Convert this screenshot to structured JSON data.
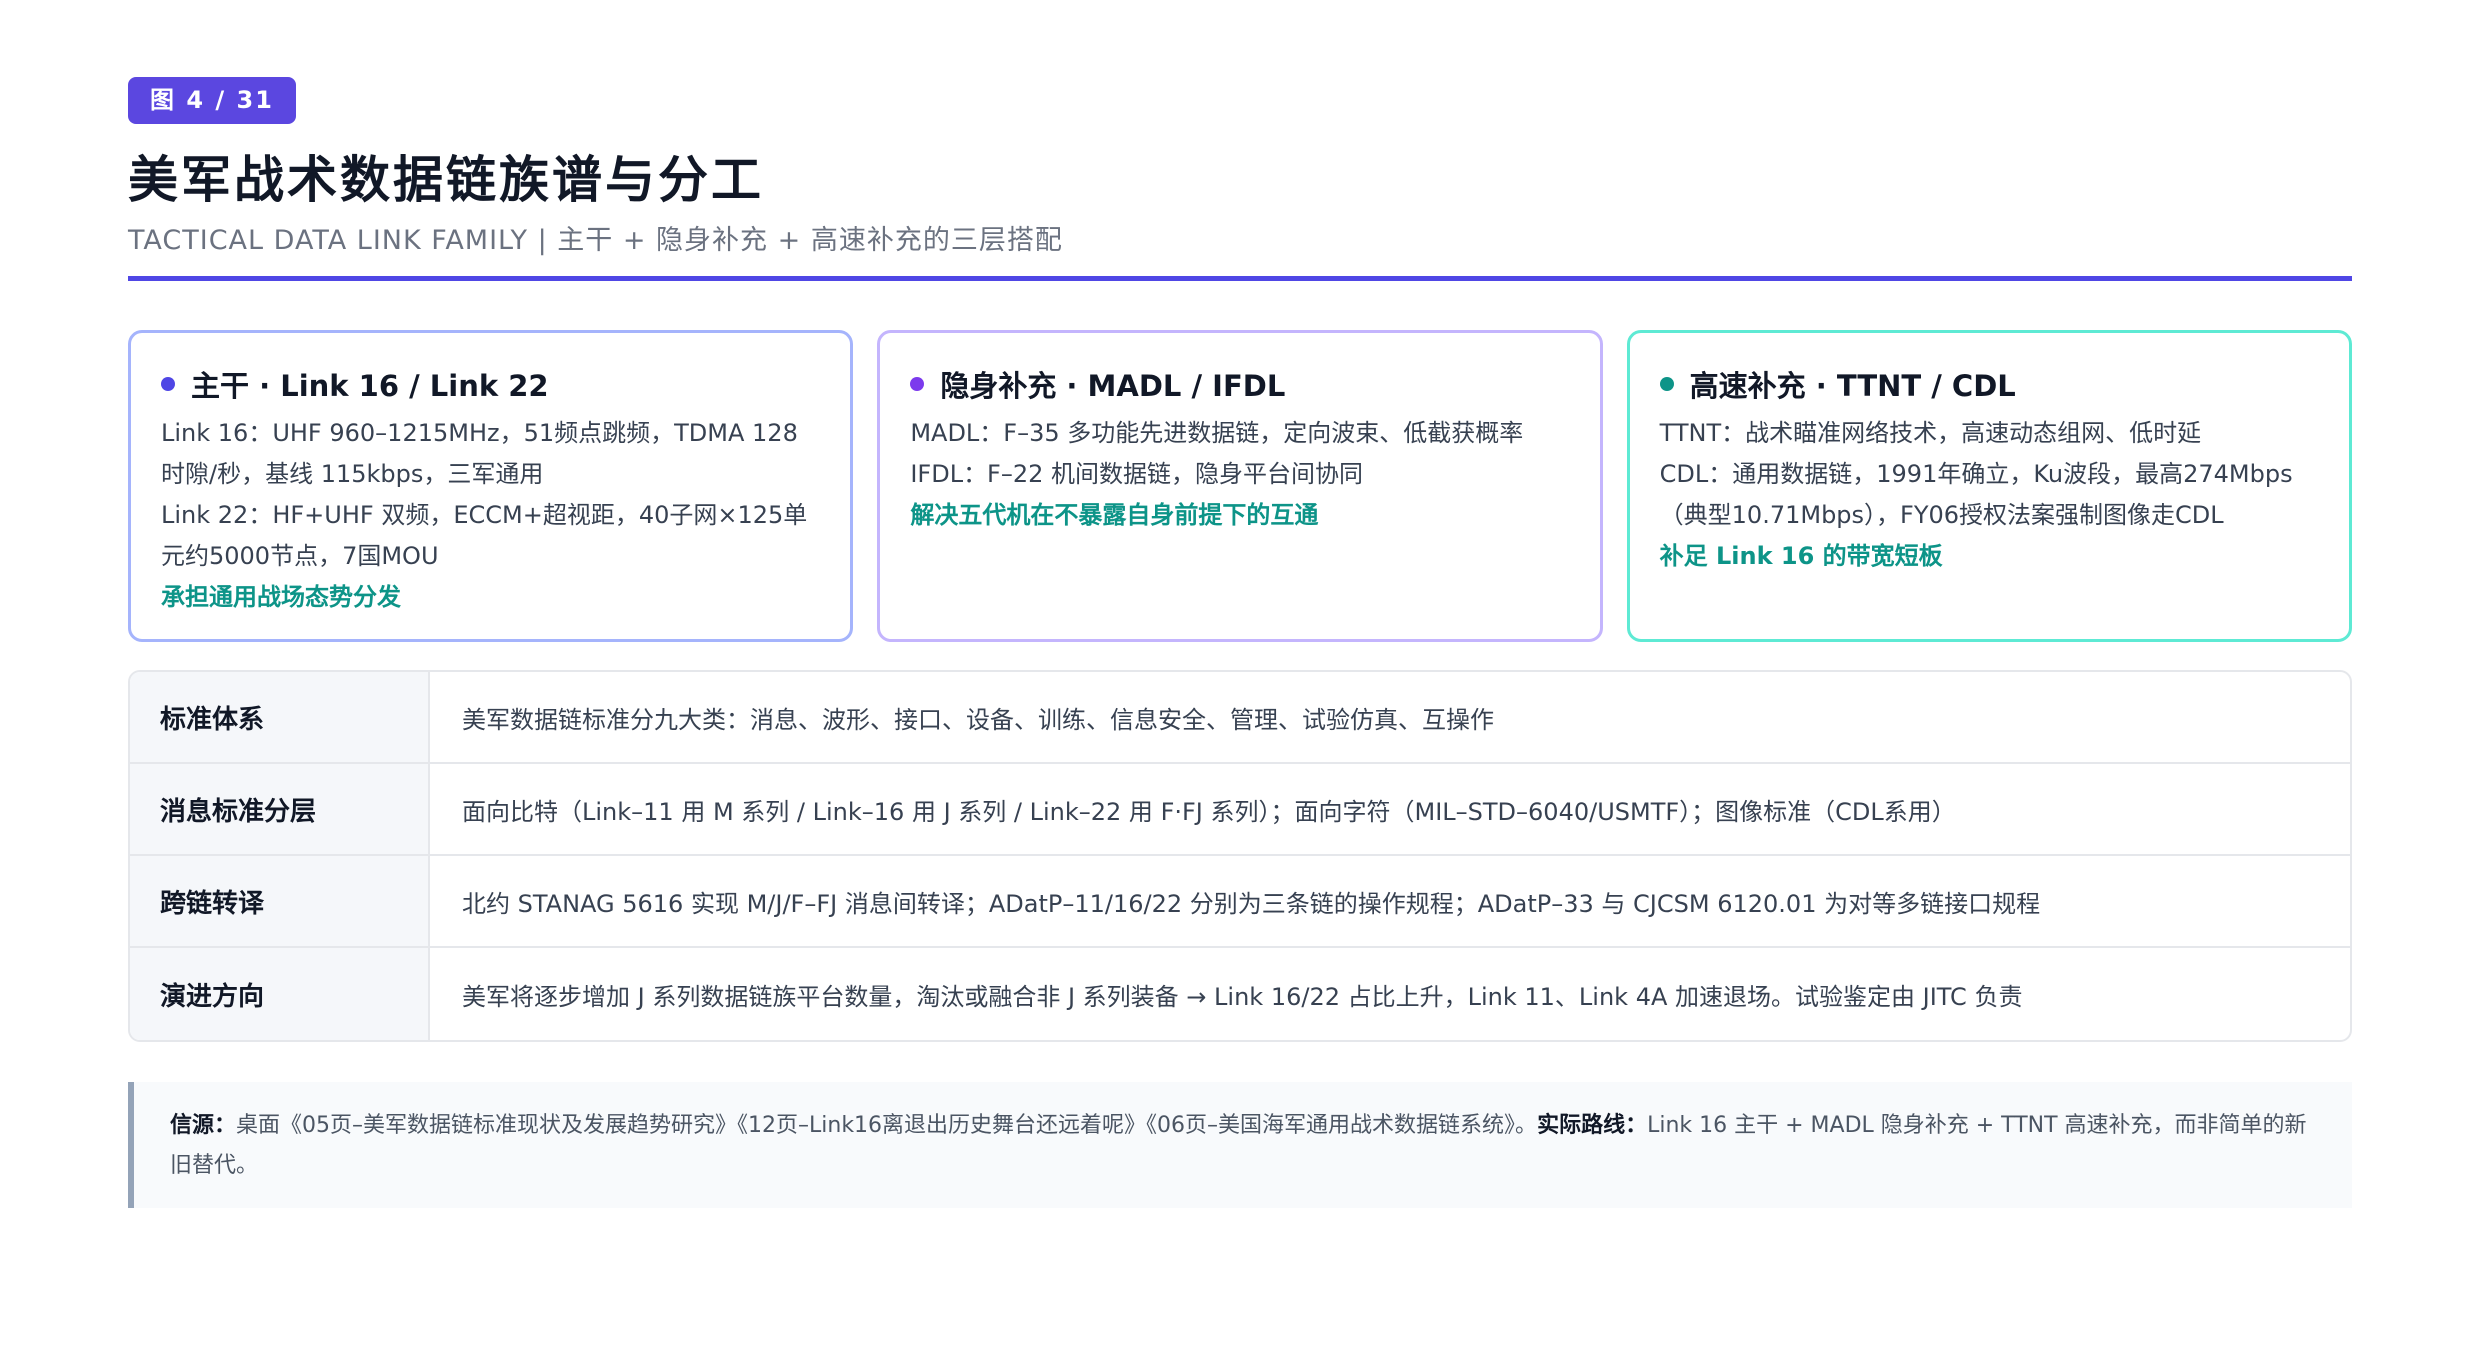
{
  "header": {
    "badge": "图 4 / 31",
    "title": "美军战术数据链族谱与分工",
    "subtitle": "TACTICAL DATA LINK FAMILY | 主干 + 隐身补充 + 高速补充的三层搭配"
  },
  "cards": [
    {
      "title": "主干 · Link 16 / Link 22",
      "lines": [
        "Link 16：UHF 960–1215MHz，51频点跳频，TDMA 128时隙/秒，基线 115kbps，三军通用",
        "Link 22：HF+UHF 双频，ECCM+超视距，40子网×125单元约5000节点，7国MOU"
      ],
      "note": "承担通用战场态势分发"
    },
    {
      "title": "隐身补充 · MADL / IFDL",
      "lines": [
        "MADL：F–35 多功能先进数据链，定向波束、低截获概率",
        "IFDL：F–22 机间数据链，隐身平台间协同"
      ],
      "note": "解决五代机在不暴露自身前提下的互通"
    },
    {
      "title": "高速补充 · TTNT / CDL",
      "lines": [
        "TTNT：战术瞄准网络技术，高速动态组网、低时延",
        "CDL：通用数据链，1991年确立，Ku波段，最高274Mbps（典型10.71Mbps），FY06授权法案强制图像走CDL"
      ],
      "note": "补足 Link 16 的带宽短板"
    }
  ],
  "table": [
    {
      "label": "标准体系",
      "content": "美军数据链标准分九大类：消息、波形、接口、设备、训练、信息安全、管理、试验仿真、互操作"
    },
    {
      "label": "消息标准分层",
      "content": "面向比特（Link–11 用 M 系列 / Link–16 用 J 系列 / Link–22 用 F·FJ 系列）；面向字符（MIL–STD–6040/USMTF）；图像标准（CDL系用）"
    },
    {
      "label": "跨链转译",
      "content": "北约 STANAG 5616 实现 M/J/F–FJ 消息间转译；ADatP–11/16/22 分别为三条链的操作规程；ADatP–33 与 CJCSM 6120.01 为对等多链接口规程"
    },
    {
      "label": "演进方向",
      "content": "美军将逐步增加 J 系列数据链族平台数量，淘汰或融合非 J 系列装备 → Link 16/22 占比上升，Link 11、Link 4A 加速退场。试验鉴定由 JITC 负责"
    }
  ],
  "source": {
    "label1": "信源：",
    "text1": "桌面《05页–美军数据链标准现状及发展趋势研究》《12页–Link16离退出历史舞台还远着呢》《06页–美国海军通用战术数据链系统》。",
    "label2": "实际路线：",
    "text2": "Link 16 主干 + MADL 隐身补充 + TTNT 高速补充，而非简单的新旧替代。"
  },
  "colors": {
    "accent": "#4f46e5",
    "badge": "#5b47e0",
    "teal": "#0d9488",
    "purple": "#7c3aed"
  }
}
